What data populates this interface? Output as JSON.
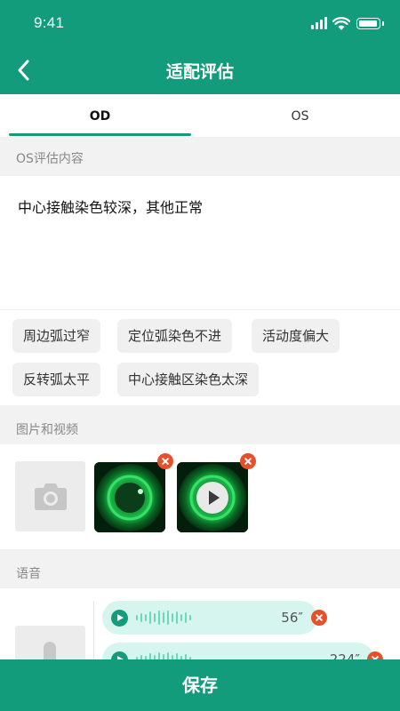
{
  "status_bar": {
    "time": "9:41"
  },
  "nav": {
    "title": "适配评估",
    "back_icon": "chevron-left-icon"
  },
  "tabs": [
    {
      "label": "OD",
      "active": true
    },
    {
      "label": "OS",
      "active": false
    }
  ],
  "notes": {
    "section_label": "OS评估内容",
    "text": "中心接触染色较深，其他正常"
  },
  "tags": [
    "周边弧过窄",
    "定位弧染色不进",
    "活动度偏大",
    "反转弧太平",
    "中心接触区染色太深"
  ],
  "media": {
    "section_label": "图片和视频",
    "add_icon": "camera-icon"
  },
  "voice": {
    "section_label": "语音",
    "clips": [
      {
        "duration": "56″"
      },
      {
        "duration": "224″"
      }
    ]
  },
  "footer": {
    "save_label": "保存"
  },
  "colors": {
    "primary": "#139c7c",
    "delete": "#e8502a",
    "bubble": "#d6f5ee"
  }
}
